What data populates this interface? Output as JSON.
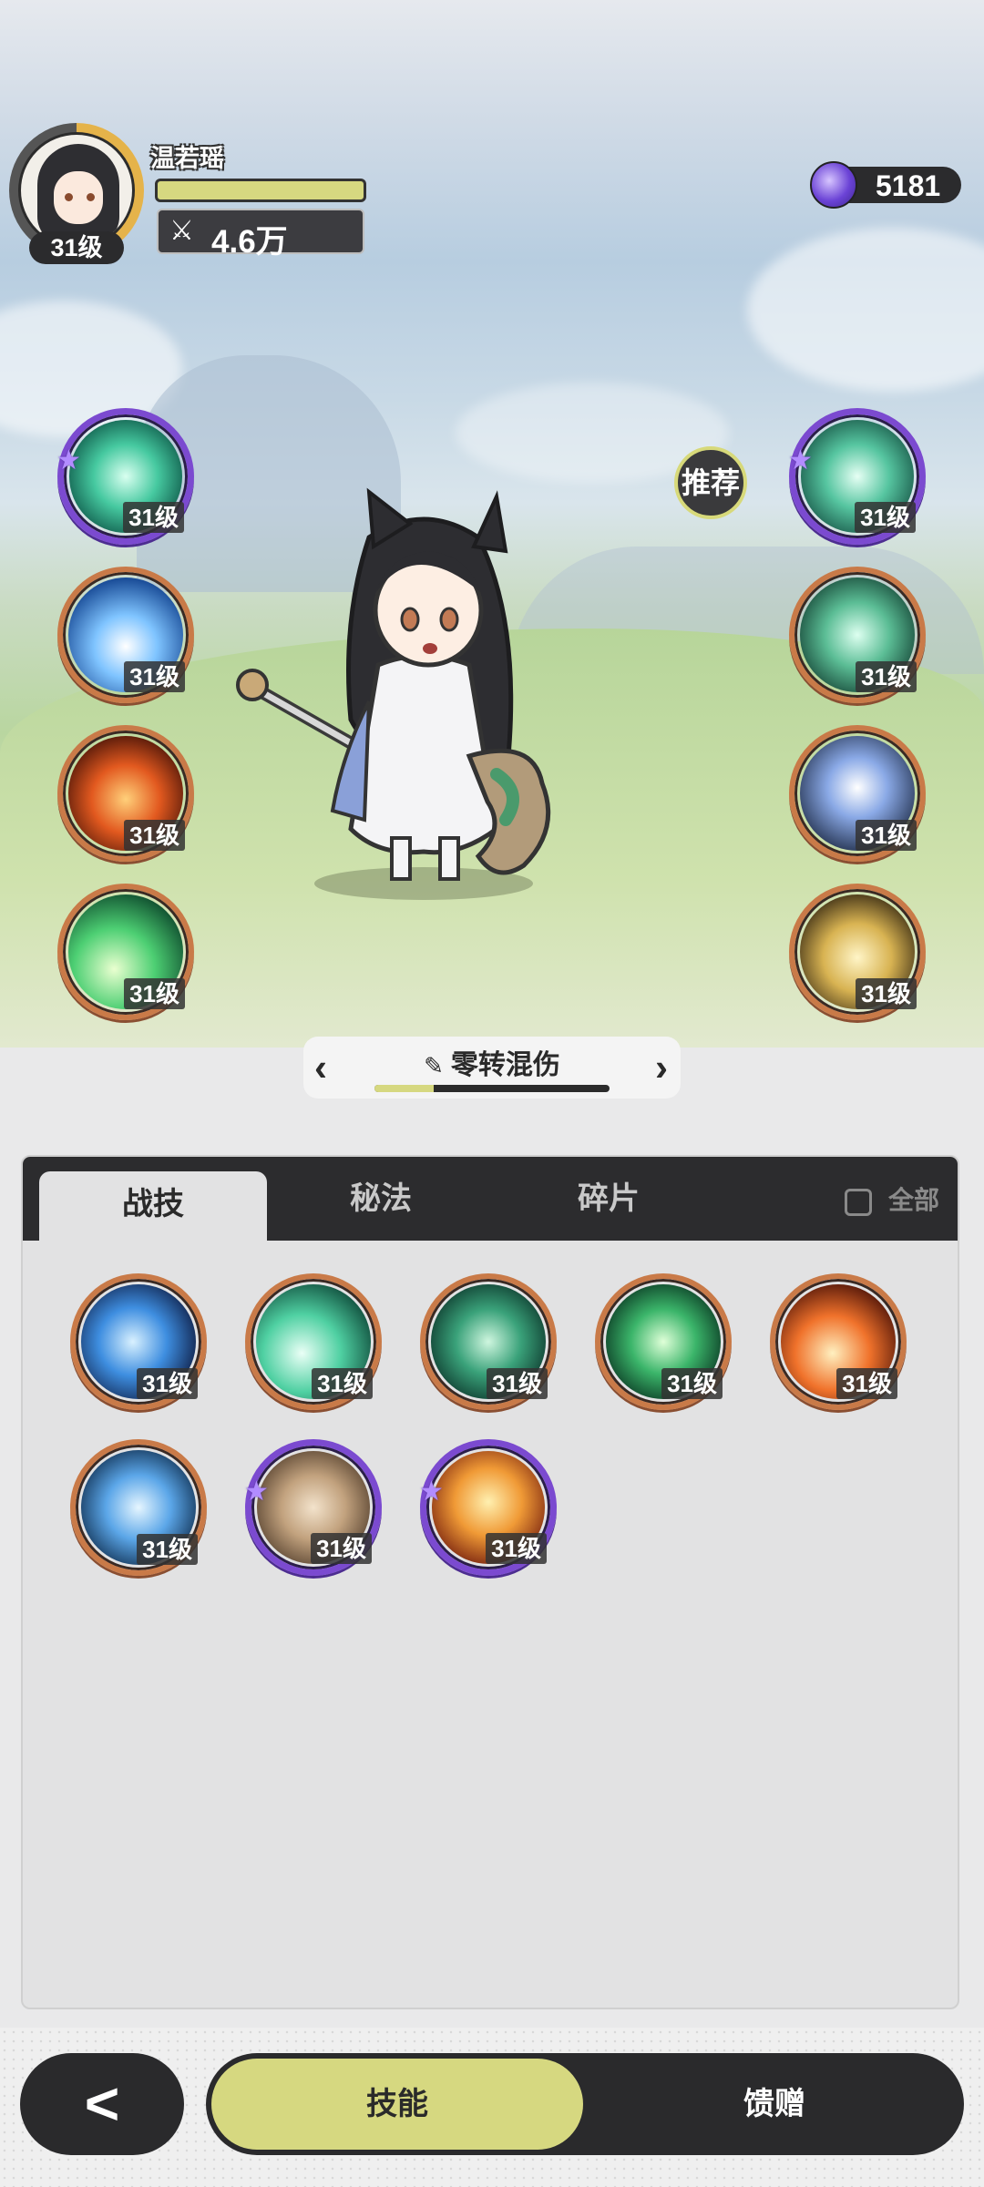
{
  "hero": {
    "name": "温若瑶",
    "level": "31级",
    "power": "4.6万",
    "hp_fraction": 1.0,
    "exp_ring_fraction": 0.6
  },
  "currency": {
    "icon": "purple-gem-icon",
    "amount": "5181"
  },
  "recommend_label": "推荐",
  "left_skills": [
    {
      "name": "green-vortex-skill-icon",
      "level": "31级",
      "rarity": "purple",
      "star": true
    },
    {
      "name": "ice-burst-skill-icon",
      "level": "31级",
      "rarity": "orange",
      "star": false
    },
    {
      "name": "fire-swirl-skill-icon",
      "level": "31级",
      "rarity": "orange",
      "star": false
    },
    {
      "name": "green-comet-skill-icon",
      "level": "31级",
      "rarity": "orange",
      "star": false
    }
  ],
  "right_skills": [
    {
      "name": "green-orb-skill-icon",
      "level": "31级",
      "rarity": "purple",
      "star": true
    },
    {
      "name": "green-shield-skill-icon",
      "level": "31级",
      "rarity": "orange",
      "star": false
    },
    {
      "name": "blue-sparkle-skill-icon",
      "level": "31级",
      "rarity": "orange",
      "star": false
    },
    {
      "name": "golden-arrow-skill-icon",
      "level": "31级",
      "rarity": "orange",
      "star": false
    }
  ],
  "preset": {
    "title": "零转混伤",
    "progress_fraction": 0.25
  },
  "tabs": [
    {
      "label": "战技",
      "active": true
    },
    {
      "label": "秘法",
      "active": false
    },
    {
      "label": "碎片",
      "active": false
    }
  ],
  "all_toggle_label": "全部",
  "owned_skills": [
    {
      "name": "blue-flame-skill-icon",
      "level": "31级",
      "rarity": "orange",
      "star": false
    },
    {
      "name": "green-wind-skill-icon",
      "level": "31级",
      "rarity": "orange",
      "star": false
    },
    {
      "name": "thorn-vine-skill-icon",
      "level": "31级",
      "rarity": "orange",
      "star": false
    },
    {
      "name": "green-heal-skill-icon",
      "level": "31级",
      "rarity": "orange",
      "star": false
    },
    {
      "name": "fire-ball-skill-icon",
      "level": "31级",
      "rarity": "orange",
      "star": false
    },
    {
      "name": "ice-crystal-skill-icon",
      "level": "31级",
      "rarity": "orange",
      "star": false
    },
    {
      "name": "card-cast-skill-icon",
      "level": "31级",
      "rarity": "purple",
      "star": true
    },
    {
      "name": "fire-fist-skill-icon",
      "level": "31级",
      "rarity": "purple",
      "star": true
    }
  ],
  "bottom": {
    "back_icon": "chevron-left-icon",
    "skills_label": "技能",
    "gift_label": "馈赠"
  }
}
